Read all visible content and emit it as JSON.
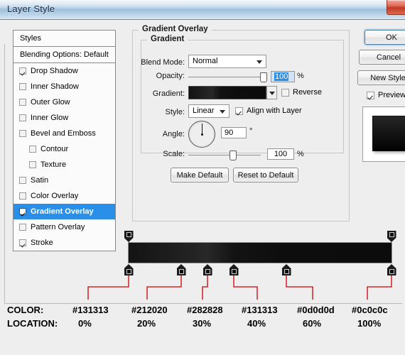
{
  "window": {
    "title": "Layer Style",
    "close_icon": "close-icon"
  },
  "styles_panel": {
    "header": "Styles",
    "subheader": "Blending Options: Default",
    "items": [
      {
        "label": "Drop Shadow",
        "checked": true,
        "indent": false,
        "selected": false
      },
      {
        "label": "Inner Shadow",
        "checked": false,
        "indent": false,
        "selected": false
      },
      {
        "label": "Outer Glow",
        "checked": false,
        "indent": false,
        "selected": false
      },
      {
        "label": "Inner Glow",
        "checked": false,
        "indent": false,
        "selected": false
      },
      {
        "label": "Bevel and Emboss",
        "checked": false,
        "indent": false,
        "selected": false
      },
      {
        "label": "Contour",
        "checked": false,
        "indent": true,
        "selected": false
      },
      {
        "label": "Texture",
        "checked": false,
        "indent": true,
        "selected": false
      },
      {
        "label": "Satin",
        "checked": false,
        "indent": false,
        "selected": false
      },
      {
        "label": "Color Overlay",
        "checked": false,
        "indent": false,
        "selected": false
      },
      {
        "label": "Gradient Overlay",
        "checked": true,
        "indent": false,
        "selected": true
      },
      {
        "label": "Pattern Overlay",
        "checked": false,
        "indent": false,
        "selected": false
      },
      {
        "label": "Stroke",
        "checked": true,
        "indent": false,
        "selected": false
      }
    ]
  },
  "gradient_overlay": {
    "group_title": "Gradient Overlay",
    "inner_group_title": "Gradient",
    "blend_mode_label": "Blend Mode:",
    "blend_mode_value": "Normal",
    "opacity_label": "Opacity:",
    "opacity_value": "100",
    "opacity_unit": "%",
    "gradient_label": "Gradient:",
    "reverse_label": "Reverse",
    "reverse_checked": false,
    "style_label": "Style:",
    "style_value": "Linear",
    "align_label": "Align with Layer",
    "align_checked": true,
    "angle_label": "Angle:",
    "angle_value": "90",
    "angle_unit": "°",
    "scale_label": "Scale:",
    "scale_value": "100",
    "scale_unit": "%",
    "make_default_label": "Make Default",
    "reset_default_label": "Reset to Default"
  },
  "right_buttons": {
    "ok_label": "OK",
    "cancel_label": "Cancel",
    "new_style_label": "New Style",
    "preview_label": "Preview",
    "preview_checked": true
  },
  "gradient_editor": {
    "top_stops": [
      {
        "position_pct": 0,
        "opacity": 100
      },
      {
        "position_pct": 100,
        "opacity": 100
      }
    ],
    "color_stops": [
      {
        "color": "#131313",
        "location": "0%",
        "position_pct": 0
      },
      {
        "color": "#212020",
        "location": "20%",
        "position_pct": 20
      },
      {
        "color": "#282828",
        "location": "30%",
        "position_pct": 30
      },
      {
        "color": "#131313",
        "location": "40%",
        "position_pct": 40
      },
      {
        "color": "#0d0d0d",
        "location": "60%",
        "position_pct": 60
      },
      {
        "color": "#0c0c0c",
        "location": "100%",
        "position_pct": 100
      }
    ]
  },
  "annotation_table": {
    "color_row_label": "COLOR:",
    "location_row_label": "LOCATION:",
    "colors": [
      "#131313",
      "#212020",
      "#282828",
      "#131313",
      "#0d0d0d",
      "#0c0c0c"
    ],
    "locations": [
      "0%",
      "20%",
      "30%",
      "40%",
      "60%",
      "100%"
    ],
    "line_color": "#cc0000"
  }
}
